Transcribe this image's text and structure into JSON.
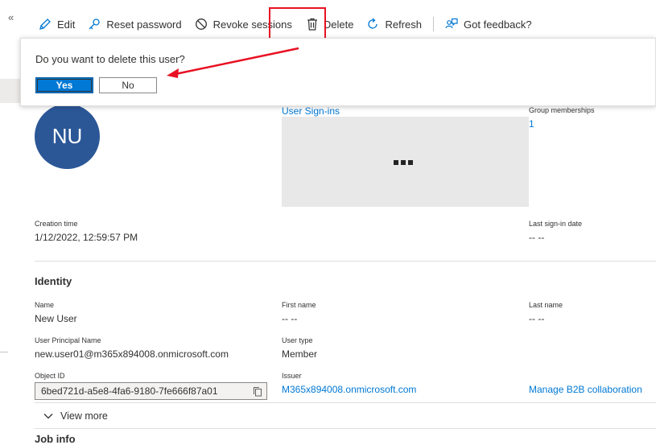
{
  "toolbar": {
    "collapse": "«",
    "edit": "Edit",
    "reset_password": "Reset password",
    "revoke_sessions": "Revoke sessions",
    "delete": "Delete",
    "refresh": "Refresh",
    "feedback": "Got feedback?"
  },
  "confirm": {
    "question": "Do you want to delete this user?",
    "yes": "Yes",
    "no": "No"
  },
  "profile": {
    "initials": "NU",
    "signins_link": "User Sign-ins",
    "group_memberships_label": "Group memberships",
    "group_memberships_value": "1",
    "creation_time_label": "Creation time",
    "creation_time_value": "1/12/2022, 12:59:57 PM",
    "last_signin_label": "Last sign-in date",
    "last_signin_value": "-- --"
  },
  "identity": {
    "title": "Identity",
    "name_label": "Name",
    "name_value": "New User",
    "first_name_label": "First name",
    "first_name_value": "-- --",
    "last_name_label": "Last name",
    "last_name_value": "-- --",
    "upn_label": "User Principal Name",
    "upn_value": "new.user01@m365x894008.onmicrosoft.com",
    "user_type_label": "User type",
    "user_type_value": "Member",
    "object_id_label": "Object ID",
    "object_id_value": "6bed721d-a5e8-4fa6-9180-7fe666f87a01",
    "issuer_label": "Issuer",
    "issuer_value": "M365x894008.onmicrosoft.com",
    "manage_b2b": "Manage B2B collaboration",
    "view_more": "View more"
  },
  "job_info": {
    "title": "Job info"
  },
  "colors": {
    "accent": "#0078d4",
    "highlight": "#e81123",
    "avatar": "#2b5797"
  }
}
